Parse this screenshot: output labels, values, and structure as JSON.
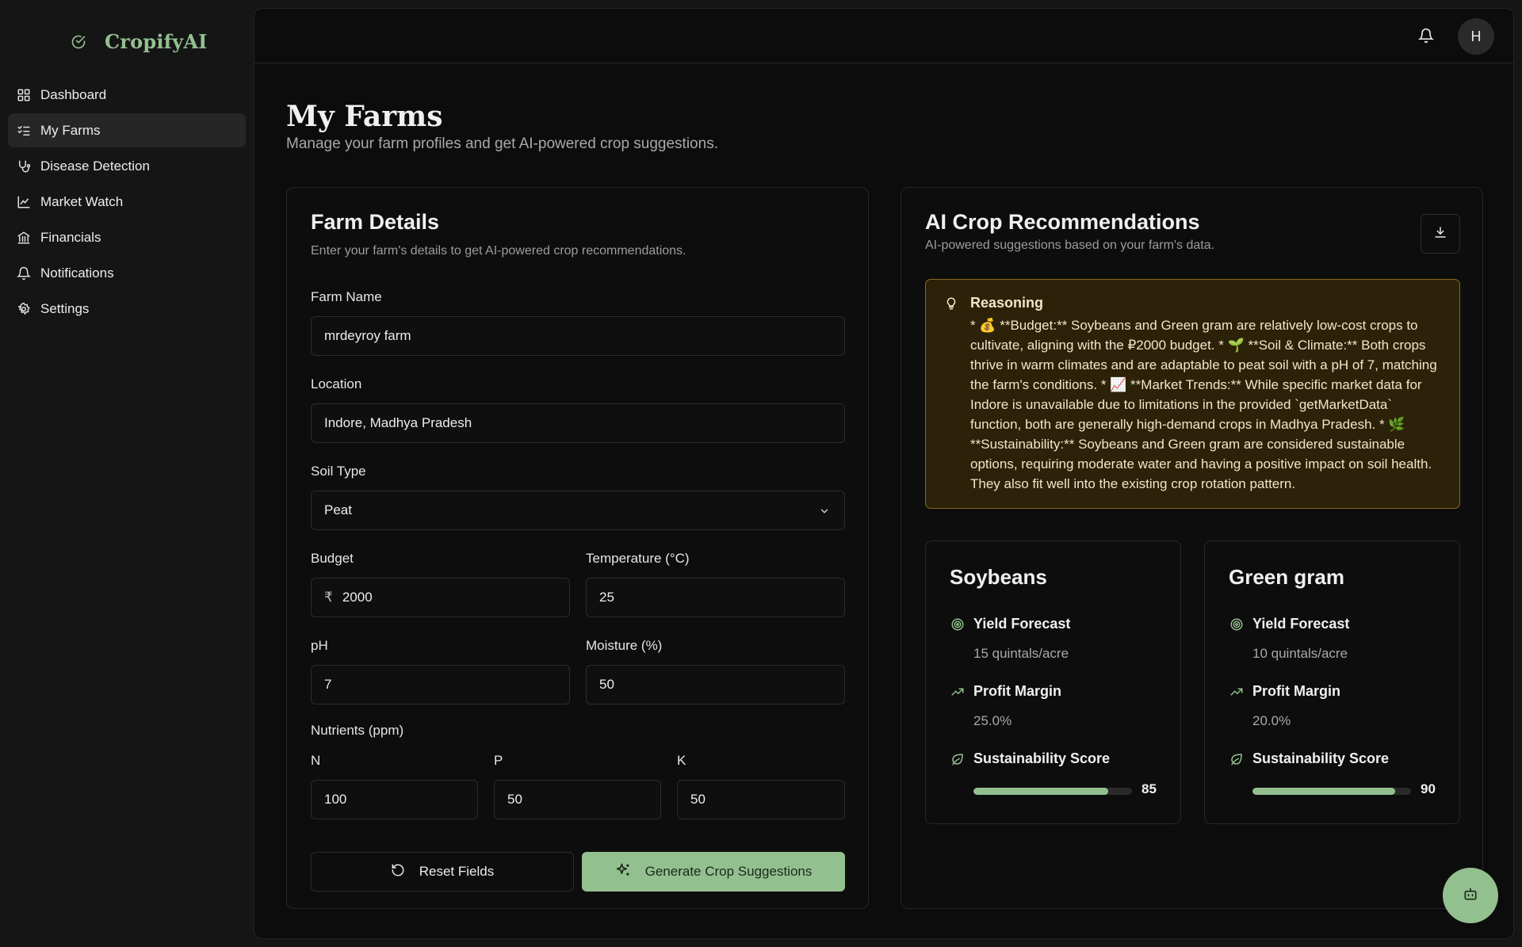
{
  "brand": {
    "name": "CropifyAI",
    "icon": "check-circle-icon",
    "color": "#93c08f"
  },
  "sidebar": {
    "items": [
      {
        "label": "Dashboard",
        "icon": "grid-icon",
        "active": false
      },
      {
        "label": "My Farms",
        "icon": "list-check-icon",
        "active": true
      },
      {
        "label": "Disease Detection",
        "icon": "stethoscope-icon",
        "active": false
      },
      {
        "label": "Market Watch",
        "icon": "line-chart-icon",
        "active": false
      },
      {
        "label": "Financials",
        "icon": "bank-icon",
        "active": false
      },
      {
        "label": "Notifications",
        "icon": "bell-icon",
        "active": false
      },
      {
        "label": "Settings",
        "icon": "gear-icon",
        "active": false
      }
    ]
  },
  "header": {
    "avatar_initial": "H"
  },
  "page": {
    "title": "My Farms",
    "subtitle": "Manage your farm profiles and get AI-powered crop suggestions."
  },
  "farm_form": {
    "title": "Farm Details",
    "subtitle": "Enter your farm's details to get AI-powered crop recommendations.",
    "farm_name": {
      "label": "Farm Name",
      "value": "mrdeyroy farm"
    },
    "location": {
      "label": "Location",
      "value": "Indore, Madhya Pradesh"
    },
    "soil_type": {
      "label": "Soil Type",
      "value": "Peat"
    },
    "budget": {
      "label": "Budget",
      "currency": "₹",
      "value": "2000"
    },
    "temperature": {
      "label": "Temperature (°C)",
      "value": "25"
    },
    "ph": {
      "label": "pH",
      "value": "7"
    },
    "moisture": {
      "label": "Moisture (%)",
      "value": "50"
    },
    "nutrients": {
      "label": "Nutrients (ppm)",
      "n": {
        "label": "N",
        "value": "100"
      },
      "p": {
        "label": "P",
        "value": "50"
      },
      "k": {
        "label": "K",
        "value": "50"
      }
    },
    "reset_label": "Reset Fields",
    "generate_label": "Generate Crop Suggestions"
  },
  "recommendations": {
    "title": "AI Crop Recommendations",
    "subtitle": "AI-powered suggestions based on your farm's data.",
    "reasoning": {
      "title": "Reasoning",
      "text": "* 💰 **Budget:** Soybeans and Green gram are relatively low-cost crops to cultivate, aligning with the ₽2000 budget. * 🌱 **Soil & Climate:** Both crops thrive in warm climates and are adaptable to peat soil with a pH of 7, matching the farm's conditions. * 📈 **Market Trends:** While specific market data for Indore is unavailable due to limitations in the provided `getMarketData` function, both are generally high-demand crops in Madhya Pradesh. * 🌿 **Sustainability:** Soybeans and Green gram are considered sustainable options, requiring moderate water and having a positive impact on soil health. They also fit well into the existing crop rotation pattern."
    },
    "crops": [
      {
        "name": "Soybeans",
        "yield_label": "Yield Forecast",
        "yield_value": "15 quintals/acre",
        "profit_label": "Profit Margin",
        "profit_value": "25.0%",
        "sustainability_label": "Sustainability Score",
        "sustainability_value": "85",
        "sustainability_score": 85
      },
      {
        "name": "Green gram",
        "yield_label": "Yield Forecast",
        "yield_value": "10 quintals/acre",
        "profit_label": "Profit Margin",
        "profit_value": "20.0%",
        "sustainability_label": "Sustainability Score",
        "sustainability_value": "90",
        "sustainability_score": 90
      }
    ]
  },
  "colors": {
    "accent": "#93c08f",
    "reasoning_bg": "#2b2209",
    "reasoning_border": "#8a6a1c"
  }
}
